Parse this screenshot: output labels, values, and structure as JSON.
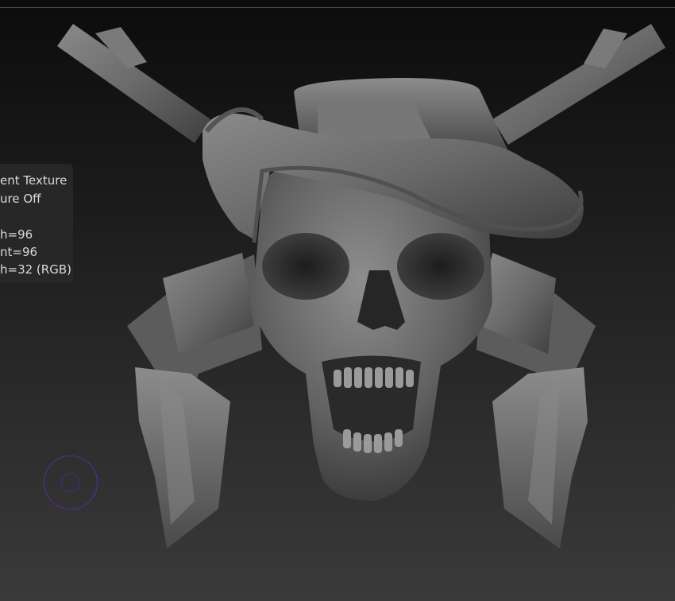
{
  "canvas": {
    "model": "skull-with-cowboy-hat-guns-model"
  },
  "tooltip": {
    "lines": [
      "ent Texture",
      "ure Off",
      "",
      "h=96",
      "nt=96",
      "h=32 (RGB)"
    ]
  },
  "colors": {
    "background_top": "#0c0c0c",
    "background_bottom": "#3a3a3a",
    "tooltip_bg": "#282828",
    "tooltip_text": "#d9d9d9",
    "brush_cursor": "#5a2aa0"
  }
}
